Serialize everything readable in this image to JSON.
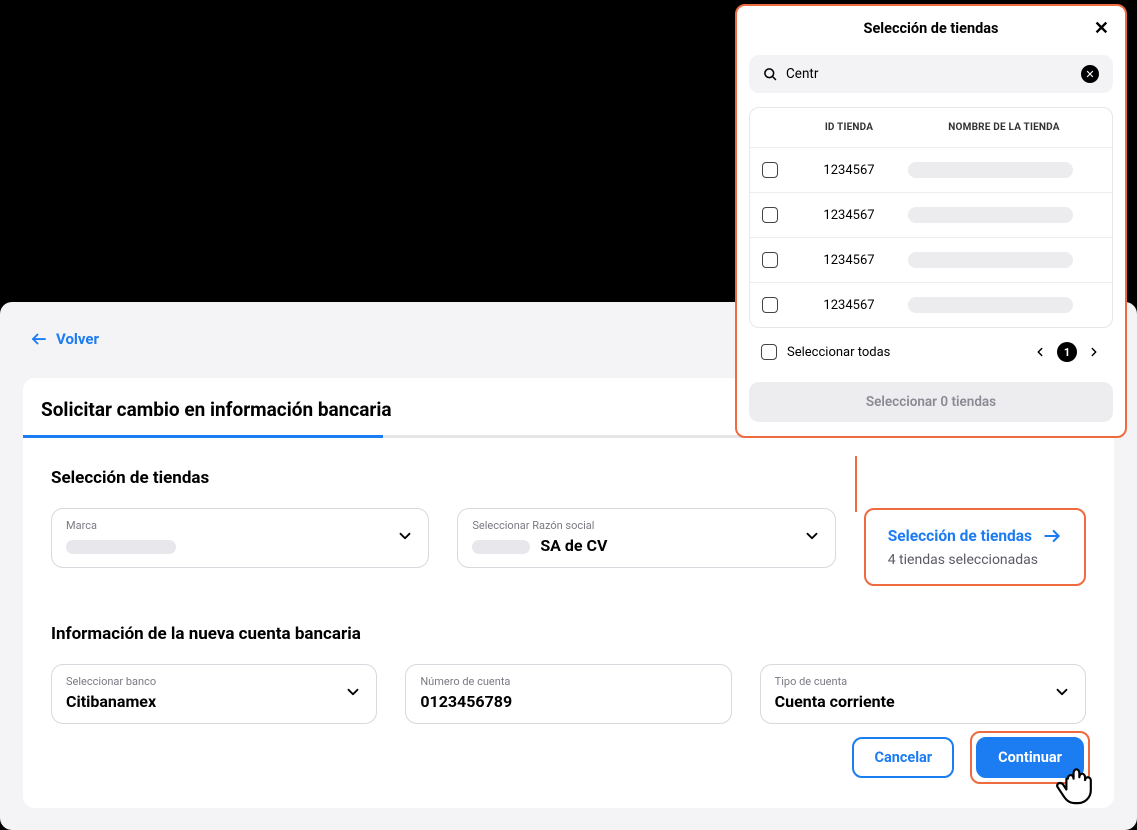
{
  "back_label": "Volver",
  "page_title": "Solicitar cambio en información bancaria",
  "section1_title": "Selección de tiendas",
  "section2_title": "Información de la nueva cuenta bancaria",
  "fields": {
    "brand": {
      "label": "Marca",
      "value": ""
    },
    "company": {
      "label": "Seleccionar Razón social",
      "value_suffix": "SA de CV"
    },
    "bank": {
      "label": "Seleccionar banco",
      "value": "Citibanamex"
    },
    "account_number": {
      "label": "Número de cuenta",
      "value": "0123456789"
    },
    "account_type": {
      "label": "Tipo de cuenta",
      "value": "Cuenta corriente"
    }
  },
  "store_callout": {
    "title": "Selección de tiendas",
    "subtitle": "4 tiendas seleccionadas"
  },
  "buttons": {
    "cancel": "Cancelar",
    "continue": "Continuar"
  },
  "modal": {
    "title": "Selección de tiendas",
    "search_value": "Centr",
    "columns": {
      "id": "ID TIENDA",
      "name": "NOMBRE DE LA TIENDA"
    },
    "rows": [
      {
        "id": "1234567"
      },
      {
        "id": "1234567"
      },
      {
        "id": "1234567"
      },
      {
        "id": "1234567"
      }
    ],
    "select_all": "Seleccionar todas",
    "page": "1",
    "action_label": "Seleccionar 0 tiendas"
  }
}
